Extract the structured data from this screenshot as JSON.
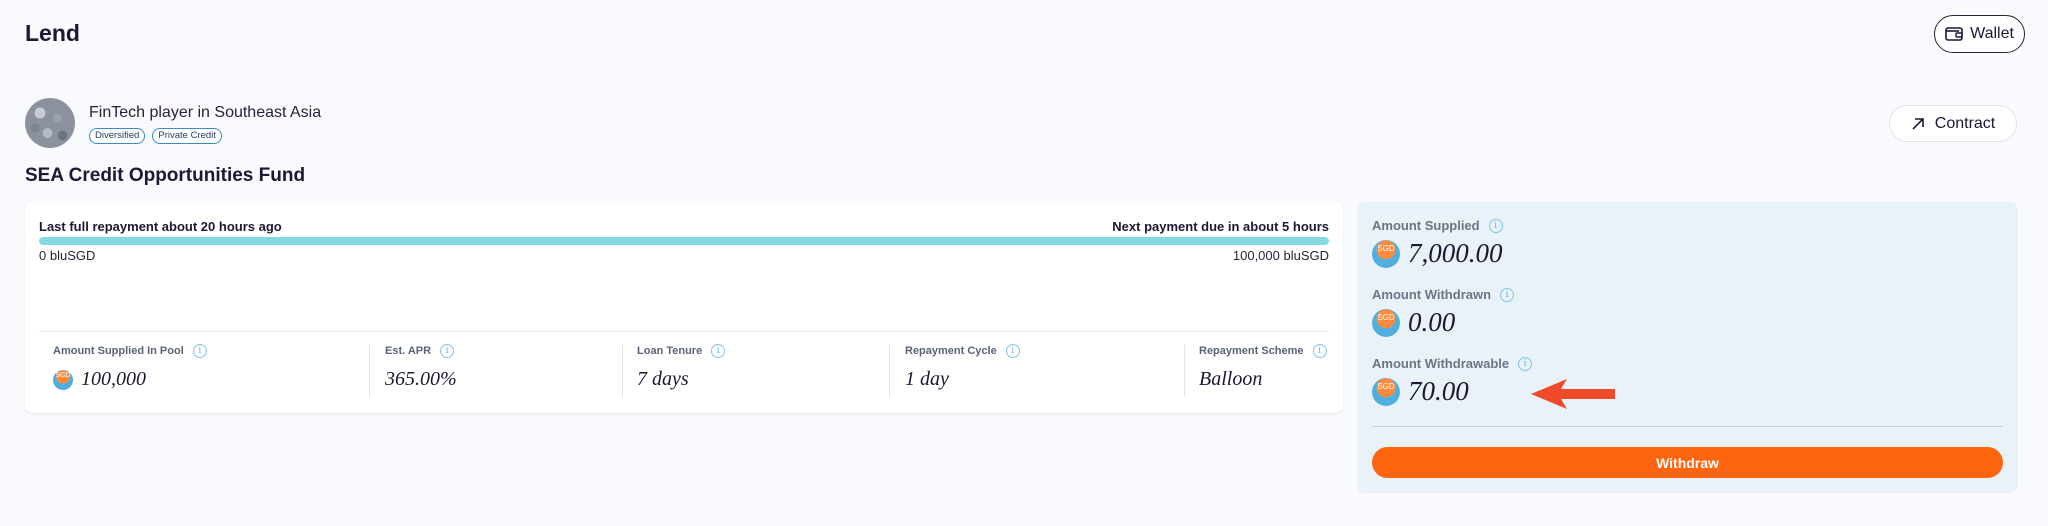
{
  "header": {
    "title": "Lend",
    "wallet_label": "Wallet"
  },
  "borrower": {
    "name": "FinTech player in Southeast Asia",
    "tags": [
      "Diversified",
      "Private Credit"
    ],
    "contract_label": "Contract"
  },
  "fund": {
    "title": "SEA Credit Opportunities Fund"
  },
  "repayment": {
    "last": "Last full repayment about 20 hours ago",
    "next": "Next payment due in about 5 hours",
    "min": "0 bluSGD",
    "max": "100,000 bluSGD",
    "progress_fraction": 1.0
  },
  "stats": [
    {
      "label": "Amount Supplied In Pool",
      "value": "100,000",
      "coin": true
    },
    {
      "label": "Est. APR",
      "value": "365.00%"
    },
    {
      "label": "Loan Tenure",
      "value": "7 days"
    },
    {
      "label": "Repayment Cycle",
      "value": "1 day"
    },
    {
      "label": "Repayment Scheme",
      "value": "Balloon"
    }
  ],
  "position": {
    "supplied_label": "Amount Supplied",
    "supplied_value": "7,000.00",
    "withdrawn_label": "Amount Withdrawn",
    "withdrawn_value": "0.00",
    "withdrawable_label": "Amount Withdrawable",
    "withdrawable_value": "70.00",
    "withdraw_label": "Withdraw"
  },
  "coin_symbol": "SGD",
  "colors": {
    "accent": "#ff6410",
    "progress": "#86d9e3",
    "arrow": "#f04a2a"
  },
  "icons": [
    "wallet-icon",
    "external-arrow-icon",
    "info-icon",
    "sgd-coin-icon",
    "annotation-arrow"
  ]
}
